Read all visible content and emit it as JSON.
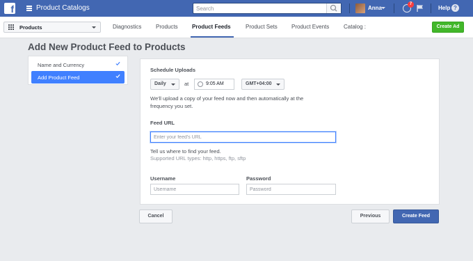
{
  "topbar": {
    "logo_glyph": "f",
    "app_title": "Product Catalogs",
    "search_placeholder": "Search",
    "user_name": "Anna",
    "notifications_count": "7",
    "help_label": "Help",
    "help_glyph": "?"
  },
  "subbar": {
    "catalog_select": "Products",
    "tabs": [
      {
        "label": "Diagnostics"
      },
      {
        "label": "Products"
      },
      {
        "label": "Product Feeds"
      },
      {
        "label": "Product Sets"
      },
      {
        "label": "Product Events"
      },
      {
        "label": "Catalog :"
      }
    ],
    "create_ad_label": "Create Ad"
  },
  "page": {
    "title": "Add New Product Feed to Products"
  },
  "steps": [
    {
      "label": "Name and Currency"
    },
    {
      "label": "Add Product Feed"
    }
  ],
  "form": {
    "schedule_heading": "Schedule Uploads",
    "frequency": "Daily",
    "at_label": "at",
    "time": "9:05 AM",
    "timezone": "GMT+04:00",
    "schedule_help_1": "We'll upload a copy of your feed now and then automatically at the",
    "schedule_help_2": "frequency you set.",
    "feed_url_heading": "Feed URL",
    "feed_url_placeholder": "Enter your feed's URL",
    "feed_url_help": "Tell us where to find your feed.",
    "supported_types": "Supported URL types: http, https, ftp, sftp",
    "username_label": "Username",
    "username_placeholder": "Username",
    "password_label": "Password",
    "password_placeholder": "Password"
  },
  "footer": {
    "cancel_label": "Cancel",
    "previous_label": "Previous",
    "create_feed_label": "Create Feed"
  }
}
